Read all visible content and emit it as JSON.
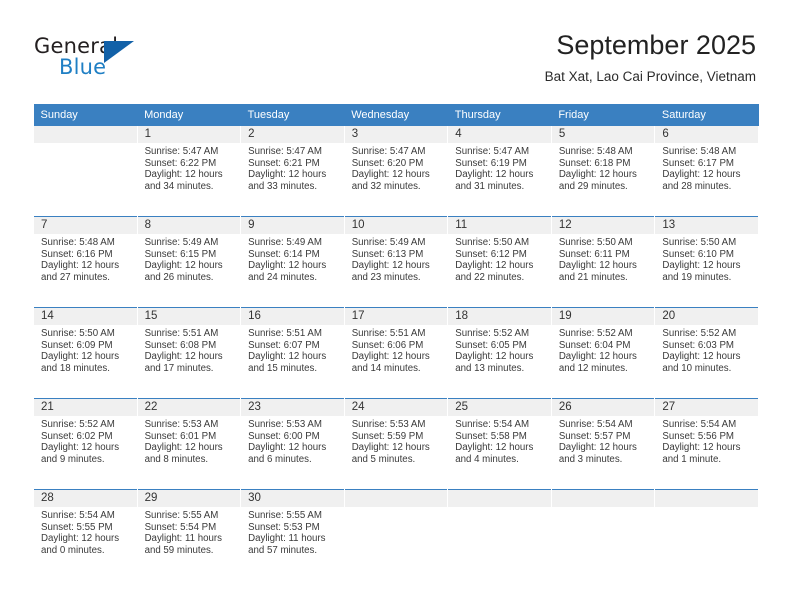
{
  "brand": {
    "name_part1": "General",
    "name_part2": "Blue",
    "triangle_icon": "blue-triangle-logo-mark"
  },
  "header": {
    "title": "September 2025",
    "subtitle": "Bat Xat, Lao Cai Province, Vietnam"
  },
  "colors": {
    "header_blue": "#3a80c1",
    "daynum_band": "#f0f0f0",
    "logo_blue": "#1f7fc4",
    "logo_dark": "#231f20",
    "text": "#3a3a3a"
  },
  "weekday_headers": [
    "Sunday",
    "Monday",
    "Tuesday",
    "Wednesday",
    "Thursday",
    "Friday",
    "Saturday"
  ],
  "weeks": [
    [
      {
        "day": "",
        "sunrise": "",
        "sunset": "",
        "daylight1": "",
        "daylight2": ""
      },
      {
        "day": "1",
        "sunrise": "Sunrise: 5:47 AM",
        "sunset": "Sunset: 6:22 PM",
        "daylight1": "Daylight: 12 hours",
        "daylight2": "and 34 minutes."
      },
      {
        "day": "2",
        "sunrise": "Sunrise: 5:47 AM",
        "sunset": "Sunset: 6:21 PM",
        "daylight1": "Daylight: 12 hours",
        "daylight2": "and 33 minutes."
      },
      {
        "day": "3",
        "sunrise": "Sunrise: 5:47 AM",
        "sunset": "Sunset: 6:20 PM",
        "daylight1": "Daylight: 12 hours",
        "daylight2": "and 32 minutes."
      },
      {
        "day": "4",
        "sunrise": "Sunrise: 5:47 AM",
        "sunset": "Sunset: 6:19 PM",
        "daylight1": "Daylight: 12 hours",
        "daylight2": "and 31 minutes."
      },
      {
        "day": "5",
        "sunrise": "Sunrise: 5:48 AM",
        "sunset": "Sunset: 6:18 PM",
        "daylight1": "Daylight: 12 hours",
        "daylight2": "and 29 minutes."
      },
      {
        "day": "6",
        "sunrise": "Sunrise: 5:48 AM",
        "sunset": "Sunset: 6:17 PM",
        "daylight1": "Daylight: 12 hours",
        "daylight2": "and 28 minutes."
      }
    ],
    [
      {
        "day": "7",
        "sunrise": "Sunrise: 5:48 AM",
        "sunset": "Sunset: 6:16 PM",
        "daylight1": "Daylight: 12 hours",
        "daylight2": "and 27 minutes."
      },
      {
        "day": "8",
        "sunrise": "Sunrise: 5:49 AM",
        "sunset": "Sunset: 6:15 PM",
        "daylight1": "Daylight: 12 hours",
        "daylight2": "and 26 minutes."
      },
      {
        "day": "9",
        "sunrise": "Sunrise: 5:49 AM",
        "sunset": "Sunset: 6:14 PM",
        "daylight1": "Daylight: 12 hours",
        "daylight2": "and 24 minutes."
      },
      {
        "day": "10",
        "sunrise": "Sunrise: 5:49 AM",
        "sunset": "Sunset: 6:13 PM",
        "daylight1": "Daylight: 12 hours",
        "daylight2": "and 23 minutes."
      },
      {
        "day": "11",
        "sunrise": "Sunrise: 5:50 AM",
        "sunset": "Sunset: 6:12 PM",
        "daylight1": "Daylight: 12 hours",
        "daylight2": "and 22 minutes."
      },
      {
        "day": "12",
        "sunrise": "Sunrise: 5:50 AM",
        "sunset": "Sunset: 6:11 PM",
        "daylight1": "Daylight: 12 hours",
        "daylight2": "and 21 minutes."
      },
      {
        "day": "13",
        "sunrise": "Sunrise: 5:50 AM",
        "sunset": "Sunset: 6:10 PM",
        "daylight1": "Daylight: 12 hours",
        "daylight2": "and 19 minutes."
      }
    ],
    [
      {
        "day": "14",
        "sunrise": "Sunrise: 5:50 AM",
        "sunset": "Sunset: 6:09 PM",
        "daylight1": "Daylight: 12 hours",
        "daylight2": "and 18 minutes."
      },
      {
        "day": "15",
        "sunrise": "Sunrise: 5:51 AM",
        "sunset": "Sunset: 6:08 PM",
        "daylight1": "Daylight: 12 hours",
        "daylight2": "and 17 minutes."
      },
      {
        "day": "16",
        "sunrise": "Sunrise: 5:51 AM",
        "sunset": "Sunset: 6:07 PM",
        "daylight1": "Daylight: 12 hours",
        "daylight2": "and 15 minutes."
      },
      {
        "day": "17",
        "sunrise": "Sunrise: 5:51 AM",
        "sunset": "Sunset: 6:06 PM",
        "daylight1": "Daylight: 12 hours",
        "daylight2": "and 14 minutes."
      },
      {
        "day": "18",
        "sunrise": "Sunrise: 5:52 AM",
        "sunset": "Sunset: 6:05 PM",
        "daylight1": "Daylight: 12 hours",
        "daylight2": "and 13 minutes."
      },
      {
        "day": "19",
        "sunrise": "Sunrise: 5:52 AM",
        "sunset": "Sunset: 6:04 PM",
        "daylight1": "Daylight: 12 hours",
        "daylight2": "and 12 minutes."
      },
      {
        "day": "20",
        "sunrise": "Sunrise: 5:52 AM",
        "sunset": "Sunset: 6:03 PM",
        "daylight1": "Daylight: 12 hours",
        "daylight2": "and 10 minutes."
      }
    ],
    [
      {
        "day": "21",
        "sunrise": "Sunrise: 5:52 AM",
        "sunset": "Sunset: 6:02 PM",
        "daylight1": "Daylight: 12 hours",
        "daylight2": "and 9 minutes."
      },
      {
        "day": "22",
        "sunrise": "Sunrise: 5:53 AM",
        "sunset": "Sunset: 6:01 PM",
        "daylight1": "Daylight: 12 hours",
        "daylight2": "and 8 minutes."
      },
      {
        "day": "23",
        "sunrise": "Sunrise: 5:53 AM",
        "sunset": "Sunset: 6:00 PM",
        "daylight1": "Daylight: 12 hours",
        "daylight2": "and 6 minutes."
      },
      {
        "day": "24",
        "sunrise": "Sunrise: 5:53 AM",
        "sunset": "Sunset: 5:59 PM",
        "daylight1": "Daylight: 12 hours",
        "daylight2": "and 5 minutes."
      },
      {
        "day": "25",
        "sunrise": "Sunrise: 5:54 AM",
        "sunset": "Sunset: 5:58 PM",
        "daylight1": "Daylight: 12 hours",
        "daylight2": "and 4 minutes."
      },
      {
        "day": "26",
        "sunrise": "Sunrise: 5:54 AM",
        "sunset": "Sunset: 5:57 PM",
        "daylight1": "Daylight: 12 hours",
        "daylight2": "and 3 minutes."
      },
      {
        "day": "27",
        "sunrise": "Sunrise: 5:54 AM",
        "sunset": "Sunset: 5:56 PM",
        "daylight1": "Daylight: 12 hours",
        "daylight2": "and 1 minute."
      }
    ],
    [
      {
        "day": "28",
        "sunrise": "Sunrise: 5:54 AM",
        "sunset": "Sunset: 5:55 PM",
        "daylight1": "Daylight: 12 hours",
        "daylight2": "and 0 minutes."
      },
      {
        "day": "29",
        "sunrise": "Sunrise: 5:55 AM",
        "sunset": "Sunset: 5:54 PM",
        "daylight1": "Daylight: 11 hours",
        "daylight2": "and 59 minutes."
      },
      {
        "day": "30",
        "sunrise": "Sunrise: 5:55 AM",
        "sunset": "Sunset: 5:53 PM",
        "daylight1": "Daylight: 11 hours",
        "daylight2": "and 57 minutes."
      },
      {
        "day": "",
        "sunrise": "",
        "sunset": "",
        "daylight1": "",
        "daylight2": ""
      },
      {
        "day": "",
        "sunrise": "",
        "sunset": "",
        "daylight1": "",
        "daylight2": ""
      },
      {
        "day": "",
        "sunrise": "",
        "sunset": "",
        "daylight1": "",
        "daylight2": ""
      },
      {
        "day": "",
        "sunrise": "",
        "sunset": "",
        "daylight1": "",
        "daylight2": ""
      }
    ]
  ]
}
